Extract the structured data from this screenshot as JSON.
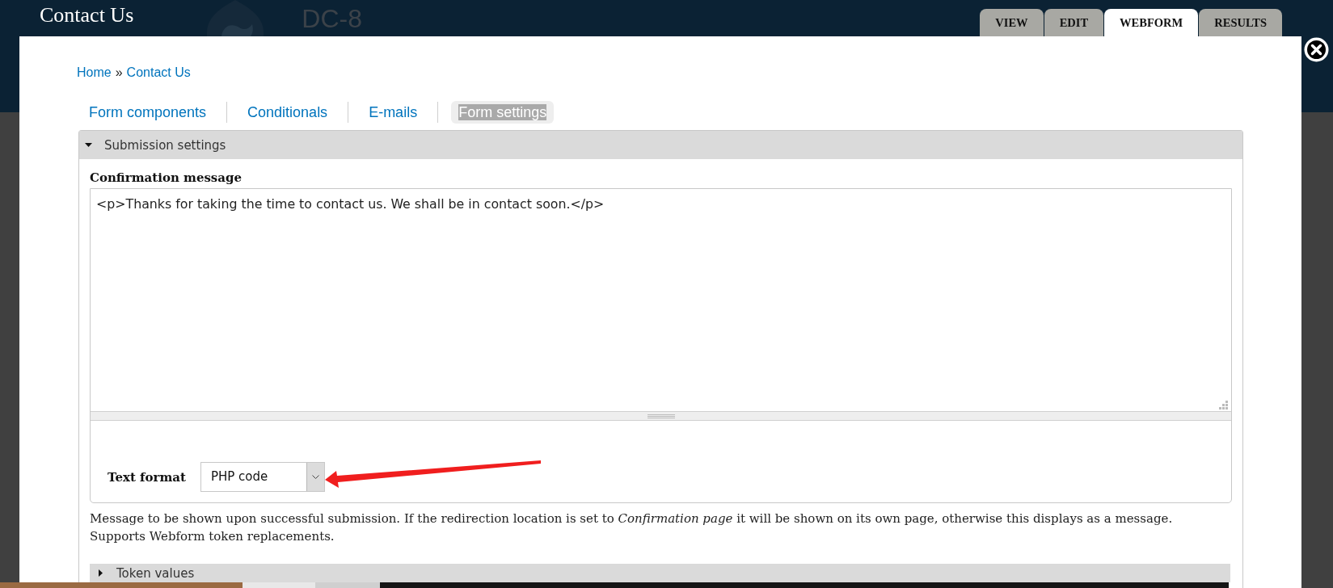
{
  "site": {
    "title": "Contact Us",
    "name": "DC-8"
  },
  "primary_tabs": [
    {
      "label": "VIEW",
      "selected": false
    },
    {
      "label": "EDIT",
      "selected": false
    },
    {
      "label": "WEBFORM",
      "selected": true
    },
    {
      "label": "RESULTS",
      "selected": false
    }
  ],
  "breadcrumb": {
    "items": [
      {
        "label": "Home"
      },
      {
        "label": "Contact Us"
      }
    ],
    "separator": "»"
  },
  "secondary_tabs": [
    {
      "label": "Form components",
      "selected": false
    },
    {
      "label": "Conditionals",
      "selected": false
    },
    {
      "label": "E-mails",
      "selected": false
    },
    {
      "label": "Form settings",
      "selected": true
    }
  ],
  "submission_settings": {
    "legend": "Submission settings",
    "expanded": true,
    "confirmation_message": {
      "label": "Confirmation message",
      "value": "<p>Thanks for taking the time to contact us. We shall be in contact soon.</p>"
    },
    "text_format": {
      "label": "Text format",
      "value": "PHP code"
    },
    "description": "Message to be shown upon successful submission. If the redirection location is set to *Confirmation page* it will be shown on its own page, otherwise this displays as a message. Supports Webform token replacements.",
    "token_values": {
      "legend": "Token values",
      "expanded": false
    }
  }
}
